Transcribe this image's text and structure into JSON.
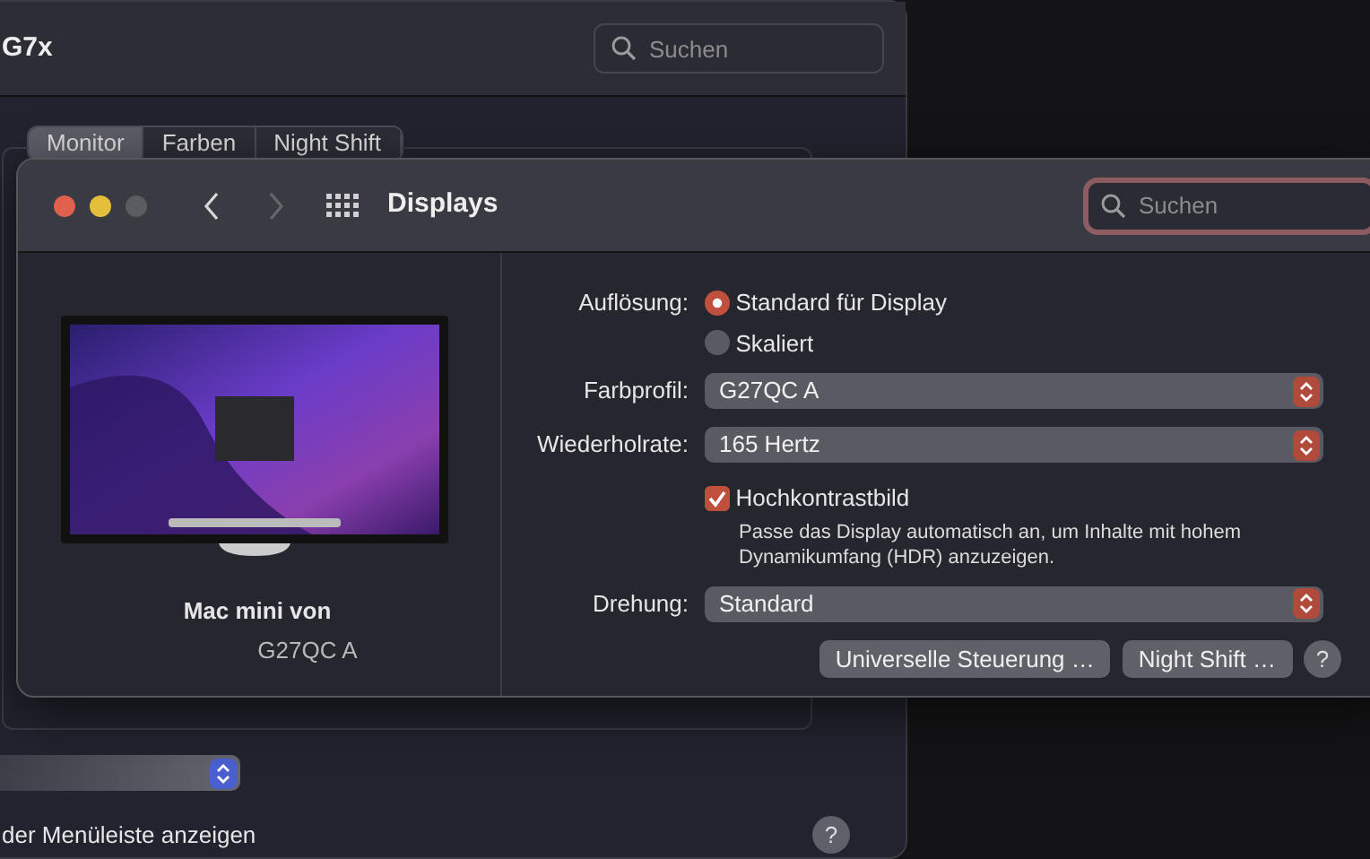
{
  "background_window": {
    "title": "G7x",
    "search": {
      "placeholder": "Suchen"
    },
    "tabs": [
      {
        "label": "Monitor",
        "selected": true
      },
      {
        "label": "Farben",
        "selected": false
      },
      {
        "label": "Night Shift",
        "selected": false
      }
    ],
    "checkbox_label": "der Menüleiste anzeigen",
    "help": "?"
  },
  "window": {
    "title": "Displays",
    "search": {
      "placeholder": "Suchen",
      "focused": true
    },
    "nav": {
      "back_enabled": true,
      "forward_enabled": false
    },
    "display": {
      "name": "Mac mini von",
      "model": "G27QC A"
    },
    "resolution": {
      "label": "Auflösung:",
      "options": [
        {
          "label": "Standard für Display",
          "selected": true
        },
        {
          "label": "Skaliert",
          "selected": false
        }
      ]
    },
    "popups": [
      {
        "label": "Farbprofil:",
        "value": "G27QC A"
      },
      {
        "label": "Wiederholrate:",
        "value": "165 Hertz"
      }
    ],
    "hdr": {
      "label": "Hochkontrastbild",
      "checked": true,
      "description": "Passe das Display automatisch an, um Inhalte mit hohem Dynamikumfang (HDR) anzuzeigen."
    },
    "rotation": {
      "label": "Drehung:",
      "value": "Standard"
    },
    "buttons": [
      "Universelle Steuerung …",
      "Night Shift …"
    ],
    "help": "?"
  }
}
